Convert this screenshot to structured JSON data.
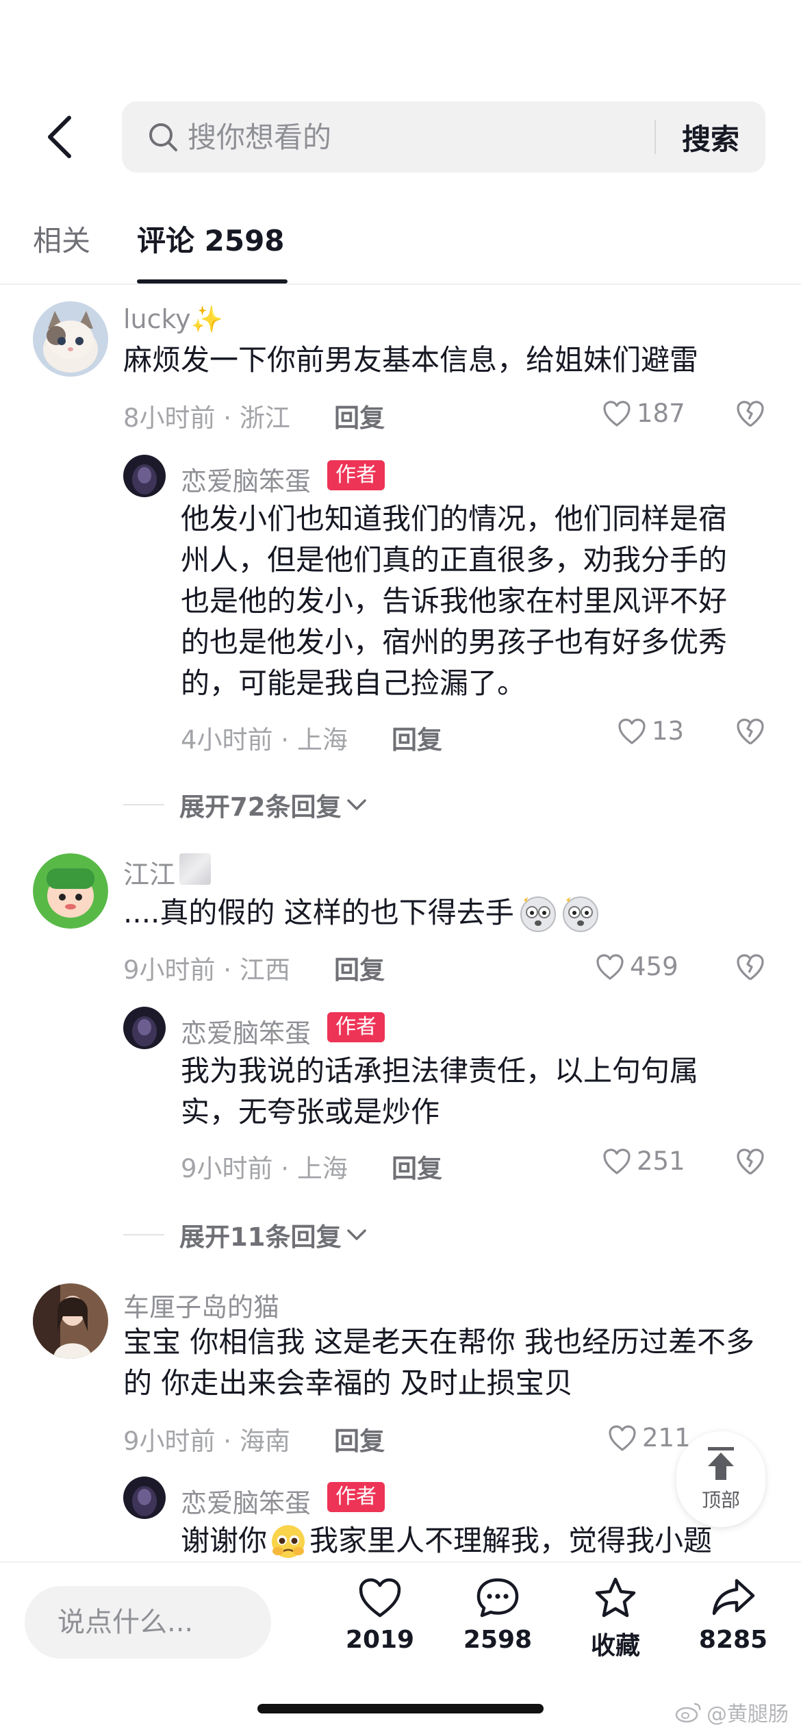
{
  "header": {
    "search_placeholder": "搜你想看的",
    "search_button": "搜索"
  },
  "tabs": {
    "related": "相关",
    "comments": "评论 2598"
  },
  "comments": [
    {
      "user": "lucky",
      "user_emoji": "✨",
      "text": "麻烦发一下你前男友基本信息，给姐妹们避雷",
      "meta": "8小时前 · 浙江",
      "reply": "回复",
      "likes": "187",
      "author_reply": {
        "user": "恋爱脑笨蛋",
        "tag": "作者",
        "text": "他发小们也知道我们的情况，他们同样是宿州人，但是他们真的正直很多，劝我分手的也是他的发小，告诉我他家在村里风评不好的也是他发小，宿州的男孩子也有好多优秀的，可能是我自己捡漏了。",
        "meta": "4小时前 · 上海",
        "reply": "回复",
        "likes": "13"
      },
      "expand": "展开72条回复"
    },
    {
      "user": "江江",
      "text": "....真的假的 这样的也下得去手",
      "meta": "9小时前 · 江西",
      "reply": "回复",
      "likes": "459",
      "author_reply": {
        "user": "恋爱脑笨蛋",
        "tag": "作者",
        "text": "我为我说的话承担法律责任，以上句句属实，无夸张或是炒作",
        "meta": "9小时前 · 上海",
        "reply": "回复",
        "likes": "251"
      },
      "expand": "展开11条回复"
    },
    {
      "user": "车厘子岛的猫",
      "text": "宝宝 你相信我 这是老天在帮你 我也经历过差不多的 你走出来会幸福的 及时止损宝贝",
      "meta": "9小时前 · 海南",
      "reply": "回复",
      "likes": "211",
      "author_reply": {
        "user": "恋爱脑笨蛋",
        "tag": "作者",
        "text_a": "谢谢你",
        "text_b": "我家里人不理解我，觉得我小题"
      }
    }
  ],
  "back_to_top": "顶部",
  "bottom_bar": {
    "input_placeholder": "说点什么...",
    "likes": "2019",
    "comments": "2598",
    "favorite": "收藏",
    "shares": "8285"
  },
  "watermark": "@黄腿肠",
  "colors": {
    "author_tag": "#ee3456",
    "text_primary": "#161823",
    "text_secondary": "#8f9095",
    "search_bg": "#f1f1f2"
  }
}
